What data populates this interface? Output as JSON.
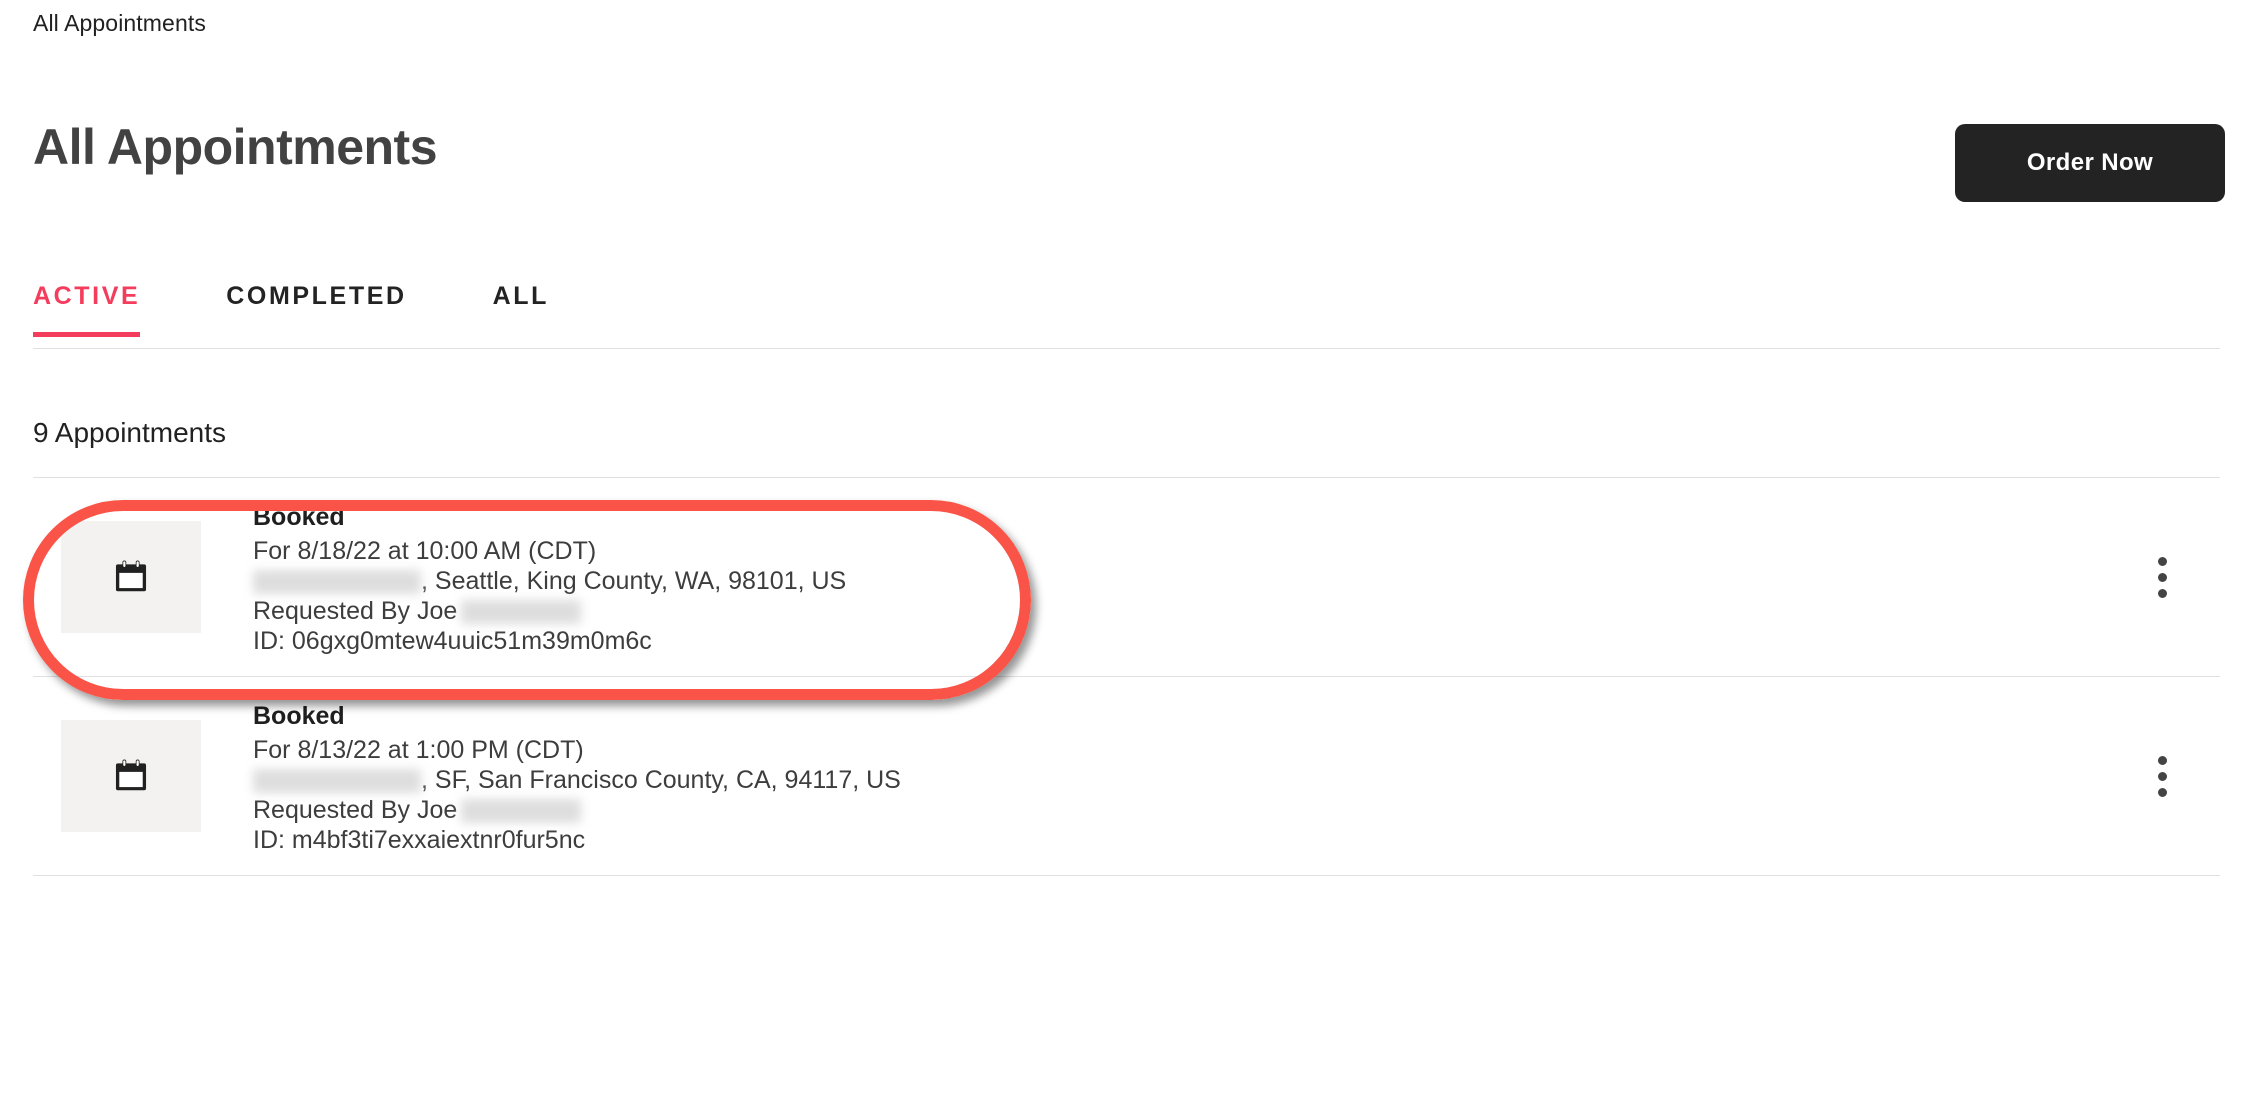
{
  "breadcrumb": {
    "label": "All Appointments"
  },
  "header": {
    "title": "All Appointments",
    "order_button_label": "Order Now",
    "order_button_color": "#232323"
  },
  "tabs": {
    "active_color": "#F43C5C",
    "items": [
      {
        "label": "ACTIVE",
        "active": true
      },
      {
        "label": "COMPLETED",
        "active": false
      },
      {
        "label": "ALL",
        "active": false
      }
    ]
  },
  "list": {
    "count_label": "9 Appointments",
    "rows": [
      {
        "status": "Booked",
        "when": "For 8/18/22 at 10:00 AM (CDT)",
        "address_redacted": true,
        "address": ", Seattle, King County, WA, 98101, US",
        "requested_by": "Requested By Joe",
        "requested_by_redacted": true,
        "id": "ID: 06gxg0mtew4uuic51m39m0m6c",
        "thumbnail_icon": "calendar-icon",
        "menu_icon": "more-vertical-icon",
        "highlighted": true
      },
      {
        "status": "Booked",
        "when": "For 8/13/22 at 1:00 PM (CDT)",
        "address_redacted": true,
        "address": ", SF, San Francisco County, CA, 94117, US",
        "requested_by": "Requested By Joe",
        "requested_by_redacted": true,
        "id": "ID: m4bf3ti7exxaiextnr0fur5nc",
        "thumbnail_icon": "calendar-icon",
        "menu_icon": "more-vertical-icon",
        "highlighted": false
      }
    ]
  },
  "annotation": {
    "shape": "rounded-oval-highlight",
    "color": "#FA5448",
    "target": "first-appointment-row"
  }
}
